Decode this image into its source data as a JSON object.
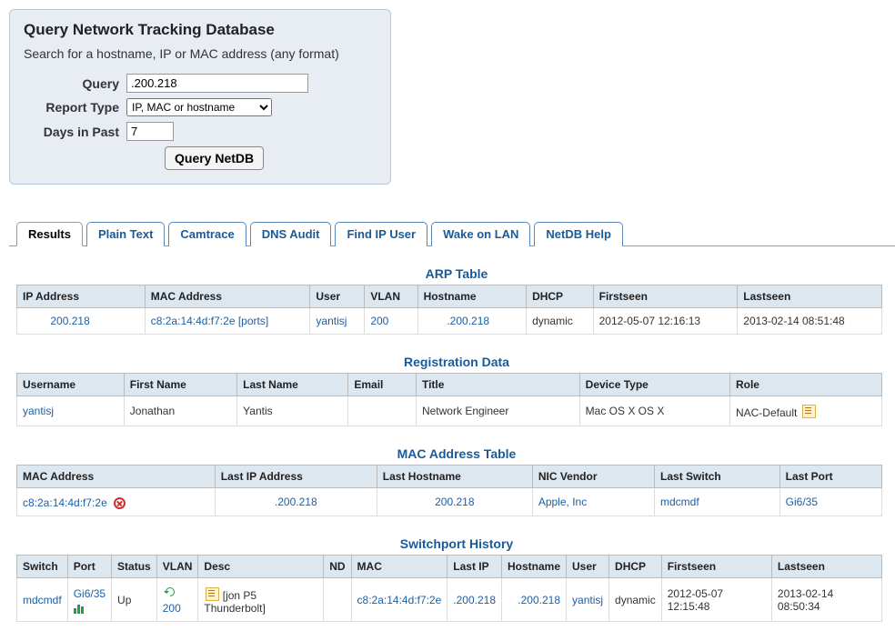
{
  "query_box": {
    "title": "Query Network Tracking Database",
    "subtitle": "Search for a hostname, IP or MAC address (any format)",
    "labels": {
      "query": "Query",
      "report_type": "Report Type",
      "days": "Days in Past"
    },
    "query_value": ".200.218",
    "report_type_value": "IP, MAC or hostname",
    "days_value": "7",
    "submit": "Query NetDB"
  },
  "tabs": [
    "Results",
    "Plain Text",
    "Camtrace",
    "DNS Audit",
    "Find IP User",
    "Wake on LAN",
    "NetDB Help"
  ],
  "active_tab": 0,
  "arp": {
    "title": "ARP Table",
    "headers": [
      "IP Address",
      "MAC Address",
      "User",
      "VLAN",
      "Hostname",
      "DHCP",
      "Firstseen",
      "Lastseen"
    ],
    "row": {
      "ip": "200.218",
      "mac": "c8:2a:14:4d:f7:2e",
      "ports": "[ports]",
      "user": "yantisj",
      "vlan": "200",
      "hostname": ".200.218",
      "dhcp": "dynamic",
      "firstseen": "2012-05-07 12:16:13",
      "lastseen": "2013-02-14 08:51:48"
    }
  },
  "reg": {
    "title": "Registration Data",
    "headers": [
      "Username",
      "First Name",
      "Last Name",
      "Email",
      "Title",
      "Device Type",
      "Role"
    ],
    "row": {
      "username": "yantisj",
      "first": "Jonathan",
      "last": "Yantis",
      "email": "",
      "title": "Network Engineer",
      "device": "Mac OS X OS X",
      "role": "NAC-Default"
    }
  },
  "mac": {
    "title": "MAC Address Table",
    "headers": [
      "MAC Address",
      "Last IP Address",
      "Last Hostname",
      "NIC Vendor",
      "Last Switch",
      "Last Port"
    ],
    "row": {
      "mac": "c8:2a:14:4d:f7:2e",
      "lastip": ".200.218",
      "lasthost": "200.218",
      "vendor": "Apple, Inc",
      "switch": "mdcmdf",
      "port": "Gi6/35"
    }
  },
  "sw": {
    "title": "Switchport History",
    "headers": [
      "Switch",
      "Port",
      "Status",
      "VLAN",
      "Desc",
      "ND",
      "MAC",
      "Last IP",
      "Hostname",
      "User",
      "DHCP",
      "Firstseen",
      "Lastseen"
    ],
    "row": {
      "switch": "mdcmdf",
      "port": "Gi6/35",
      "status": "Up",
      "vlan": "200",
      "desc": "[jon P5 Thunderbolt]",
      "nd": "",
      "mac": "c8:2a:14:4d:f7:2e",
      "lastip": ".200.218",
      "hostname": ".200.218",
      "user": "yantisj",
      "dhcp": "dynamic",
      "firstseen": "2012-05-07 12:15:48",
      "lastseen": "2013-02-14 08:50:34"
    }
  }
}
